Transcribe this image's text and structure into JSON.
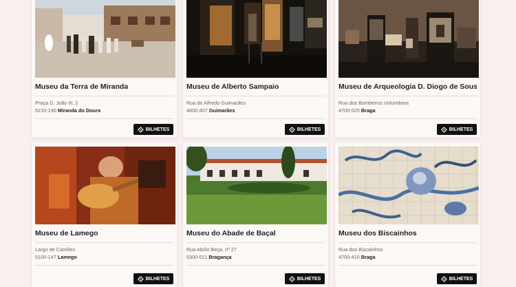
{
  "museums": [
    {
      "name": "Museu da Terra de Miranda",
      "street": "Praça D. João III, 2",
      "postcode": "5210-190",
      "city": "Miranda do Douro",
      "button": "BILHETES",
      "photo_description": "town-square-with-folk-dancers"
    },
    {
      "name": "Museu de Alberto Sampaio",
      "street": "Rua de Alfredo Guimarães",
      "postcode": "4800-407",
      "city": "Guimarães",
      "button": "BILHETES",
      "photo_description": "dark-gallery-with-sacred-art"
    },
    {
      "name": "Museu de Arqueologia D. Diogo de Sousa",
      "street": "Rua dos Bombeiros Voluntários",
      "postcode": "4700-025",
      "city": "Braga",
      "button": "BILHETES",
      "photo_description": "archaeology-display-cases"
    },
    {
      "name": "Museu de Lamego",
      "street": "Largo de Camões",
      "postcode": "5100-147",
      "city": "Lamego",
      "button": "BILHETES",
      "photo_description": "renaissance-painting-lute-player"
    },
    {
      "name": "Museu do Abade de Baçal",
      "street": "Rua Abílio Beça, nº 27",
      "postcode": "5300-011",
      "city": "Bragança",
      "button": "BILHETES",
      "photo_description": "white-building-with-garden"
    },
    {
      "name": "Museu dos Biscainhos",
      "street": "Rua dos Biscainhos",
      "postcode": "4700-415",
      "city": "Braga",
      "button": "BILHETES",
      "photo_description": "blue-azulejo-tiles-cherub"
    }
  ],
  "colors": {
    "page_background": "#f8efee",
    "card_background": "#fbf8f5",
    "button_background": "#111111",
    "button_text": "#ffffff"
  },
  "icons": {
    "ticket": "ticket-icon"
  }
}
